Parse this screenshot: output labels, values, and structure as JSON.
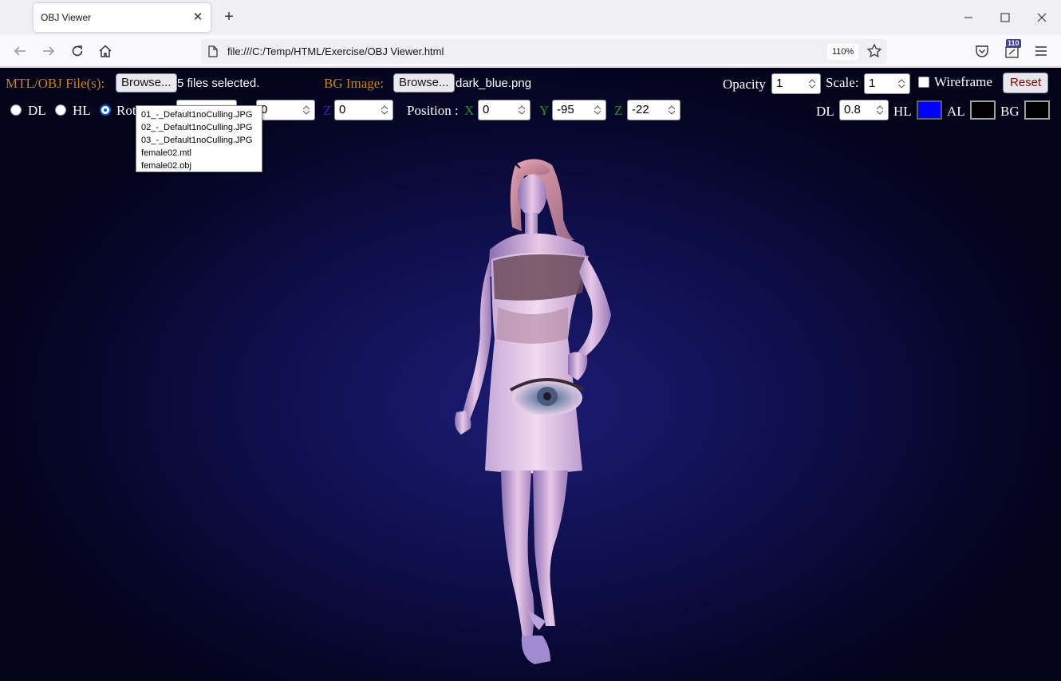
{
  "browser": {
    "tab_title": "OBJ Viewer",
    "url": "file:///C:/Temp/HTML/Exercise/OBJ Viewer.html",
    "zoom": "110%",
    "extension_badge": "110"
  },
  "toolbar1": {
    "files_label": "MTL/OBJ File(s):",
    "browse_label": "Browse...",
    "files_status": "5 files selected.",
    "bg_label": "BG Image:",
    "bg_browse_label": "Browse...",
    "bg_file": "dark_blue.png",
    "opacity_label": "Opacity",
    "opacity_value": "1",
    "scale_label": "Scale:",
    "scale_value": "1",
    "wireframe_label": "Wireframe",
    "wireframe_checked": false,
    "reset_label": "Reset"
  },
  "toolbar2": {
    "dl_label": "DL",
    "hl_label": "HL",
    "rot_label": "Rot",
    "rot_y_value": "0",
    "rot_z_label": "Z",
    "rot_z_value": "0",
    "position_label": "Position :",
    "x_label": "X",
    "x_value": "0",
    "y_label": "Y",
    "y_value": "-95",
    "z_label": "Z",
    "z_value": "-22",
    "dl_value_label": "DL",
    "dl_value": "0.8",
    "hl_color_label": "HL",
    "al_color_label": "AL",
    "bg_color_label": "BG",
    "selected_radio": "Rot"
  },
  "colors": {
    "hl": "#0000ff",
    "al": "#000000",
    "bg": "#000000",
    "label_gold": "#c8861a",
    "label_green": "#1a9a1a"
  },
  "file_list": [
    "01_-_Default1noCulling.JPG",
    "02_-_Default1noCulling.JPG",
    "03_-_Default1noCulling.JPG",
    "female02.mtl",
    "female02.obj"
  ]
}
